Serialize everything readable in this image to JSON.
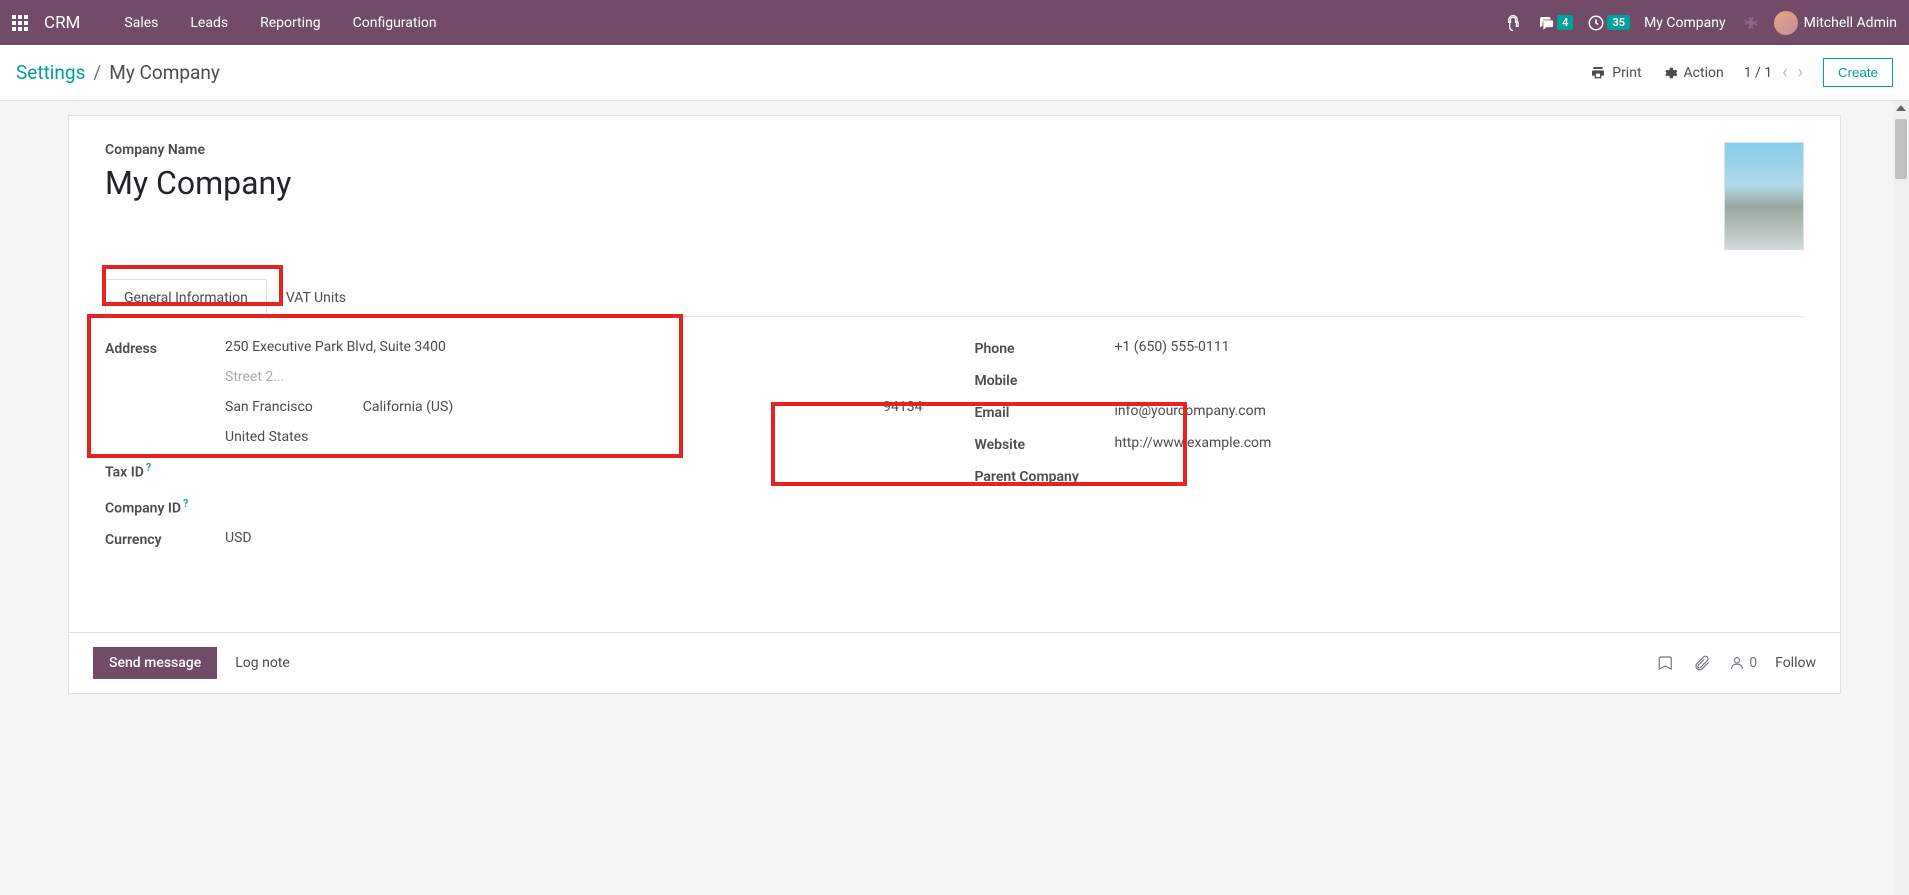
{
  "nav": {
    "brand": "CRM",
    "items": [
      "Sales",
      "Leads",
      "Reporting",
      "Configuration"
    ],
    "msg_badge": "4",
    "activity_badge": "35",
    "company": "My Company",
    "user": "Mitchell Admin"
  },
  "header": {
    "breadcrumb_root": "Settings",
    "breadcrumb_current": "My Company",
    "print": "Print",
    "action": "Action",
    "pager": "1 / 1",
    "create": "Create"
  },
  "form": {
    "name_label": "Company Name",
    "name": "My Company",
    "tabs": {
      "general": "General Information",
      "vat": "VAT Units"
    },
    "left": {
      "address_label": "Address",
      "street": "250 Executive Park Blvd, Suite 3400",
      "street2_ph": "Street 2...",
      "city": "San Francisco",
      "state": "California (US)",
      "zip": "94134",
      "country": "United States",
      "taxid_label": "Tax ID",
      "companyid_label": "Company ID",
      "currency_label": "Currency",
      "currency": "USD"
    },
    "right": {
      "phone_label": "Phone",
      "phone": "+1 (650) 555-0111",
      "mobile_label": "Mobile",
      "email_label": "Email",
      "email": "info@yourcompany.com",
      "website_label": "Website",
      "website": "http://www.example.com",
      "parent_label": "Parent Company"
    }
  },
  "chatter": {
    "send": "Send message",
    "log": "Log note",
    "followers": "0",
    "follow": "Follow"
  }
}
